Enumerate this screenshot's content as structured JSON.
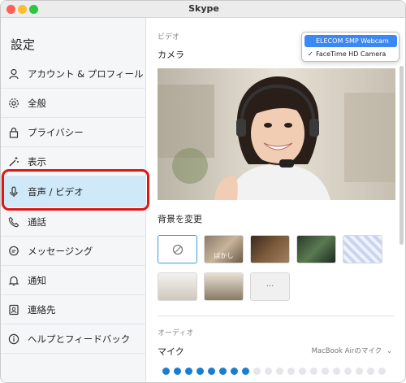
{
  "window": {
    "title": "Skype"
  },
  "sidebar": {
    "title": "設定",
    "items": [
      {
        "label": "アカウント & プロフィール",
        "icon": "person-icon"
      },
      {
        "label": "全般",
        "icon": "gear-icon"
      },
      {
        "label": "プライバシー",
        "icon": "lock-icon"
      },
      {
        "label": "表示",
        "icon": "magic-wand-icon"
      },
      {
        "label": "音声 / ビデオ",
        "icon": "microphone-icon"
      },
      {
        "label": "通話",
        "icon": "phone-icon"
      },
      {
        "label": "メッセージング",
        "icon": "chat-bubble-icon"
      },
      {
        "label": "通知",
        "icon": "bell-icon"
      },
      {
        "label": "連絡先",
        "icon": "contact-card-icon"
      },
      {
        "label": "ヘルプとフィードバック",
        "icon": "info-icon"
      }
    ],
    "active_index": 4
  },
  "video": {
    "section_label": "ビデオ",
    "camera_label": "カメラ",
    "camera_options": [
      {
        "label": "ELECOM 5MP Webcam",
        "highlighted": true,
        "checked": false
      },
      {
        "label": "FaceTime HD Camera",
        "highlighted": false,
        "checked": true
      }
    ],
    "background_label": "背景を変更",
    "blur_label": "ぼかし",
    "more_label": "···"
  },
  "audio": {
    "section_label": "オーディオ",
    "mic_label": "マイク",
    "mic_device": "MacBook Airのマイク",
    "level_filled": 8,
    "level_total": 20
  },
  "colors": {
    "accent": "#3b88f5",
    "active_item": "#cfe9f8",
    "highlight_box": "#e01515",
    "level_dot": "#1a7dd1"
  }
}
